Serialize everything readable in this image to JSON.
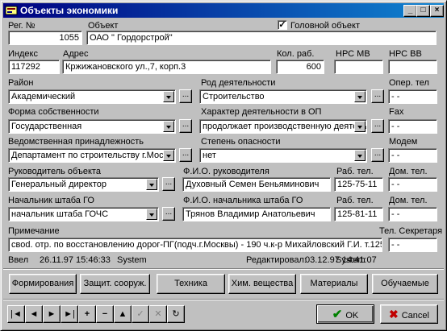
{
  "window": {
    "title": "Объекты экономики"
  },
  "labels": {
    "reg_no": "Рег. №",
    "object": "Объект",
    "main_object": "Головной объект",
    "index": "Индекс",
    "address": "Адрес",
    "workers": "Кол. раб.",
    "nrs_mv": "НРС МВ",
    "nrs_vv": "НРС ВВ",
    "district": "Район",
    "activity": "Род деятельности",
    "oper_tel": "Опер. тел",
    "ownership": "Форма  собственности",
    "op_character": "Характер деятельности в ОП",
    "fax": "Fax",
    "department": "Ведомственная принадлежность",
    "danger": "Степень опасности",
    "modem": "Модем",
    "head": "Руководитель объекта",
    "head_name": "Ф.И.О. руководителя",
    "work_tel": "Раб. тел.",
    "home_tel": "Дом. тел.",
    "go_chief": "Начальник штаба ГО",
    "go_chief_name": "Ф.И.О. начальника штаба ГО",
    "work_tel2": "Раб. тел.",
    "home_tel2": "Дом. тел.",
    "note": "Примечание",
    "sec_tel": "Тел. Секретаря"
  },
  "fields": {
    "reg_no": "1055",
    "object": "ОАО \" Гордорстрой\"",
    "main_object_checked": true,
    "index": "117292",
    "address": "Кржижановского ул.,7, корп.3",
    "workers": "600",
    "nrs_mv": "",
    "nrs_vv": "",
    "district": "Академический",
    "activity": "Строительство",
    "oper_tel": " - -",
    "ownership": "Государственная",
    "op_character": "продолжает производственную деятель",
    "fax": " - -",
    "department": "Департамент по строительству г.Москв",
    "danger": "нет",
    "modem": " - -",
    "head": "Генеральный директор",
    "head_name": "Духовный Семен Беньяминович",
    "head_work_tel": "125-75-11",
    "head_home_tel": " - -",
    "go_chief": "начальник штаба ГОЧС",
    "go_chief_name": "Трянов Владимир Анатольевич",
    "go_work_tel": "125-81-11",
    "go_home_tel": " - -",
    "note": "своd. отр. по восстановлению дорог-ПГ(подч.г.Москвы) - 190 ч.к-р Михайловский Г.И.  т.1257311",
    "sec_tel": " - -"
  },
  "status": {
    "entered_label": "Ввел",
    "entered_date": "26.11.97 15:46:33",
    "entered_by": "System",
    "edited_label": "Редактировал:",
    "edited_date": "03.12.97 14:41:07",
    "edited_by": "System"
  },
  "buttons": {
    "formations": "Формирования",
    "shelters": "Защит. сооруж.",
    "equipment": "Техника",
    "chemicals": "Хим. вещества",
    "materials": "Материалы",
    "training": "Обучаемые",
    "ok": "OK",
    "cancel": "Cancel",
    "dots": "..."
  },
  "nav": {
    "first": "|◄",
    "prior": "◄",
    "next": "►",
    "last": "►|",
    "insert": "+",
    "delete": "−",
    "edit": "▲",
    "post": "✓",
    "cancel": "✕",
    "refresh": "↻"
  },
  "title_buttons": {
    "min": "_",
    "max": "□",
    "close": "×"
  },
  "colors": {
    "title_start": "#000080",
    "title_end": "#1084d0",
    "face": "#c0c0c0",
    "ok_green": "#008000",
    "cancel_red": "#c00000"
  }
}
